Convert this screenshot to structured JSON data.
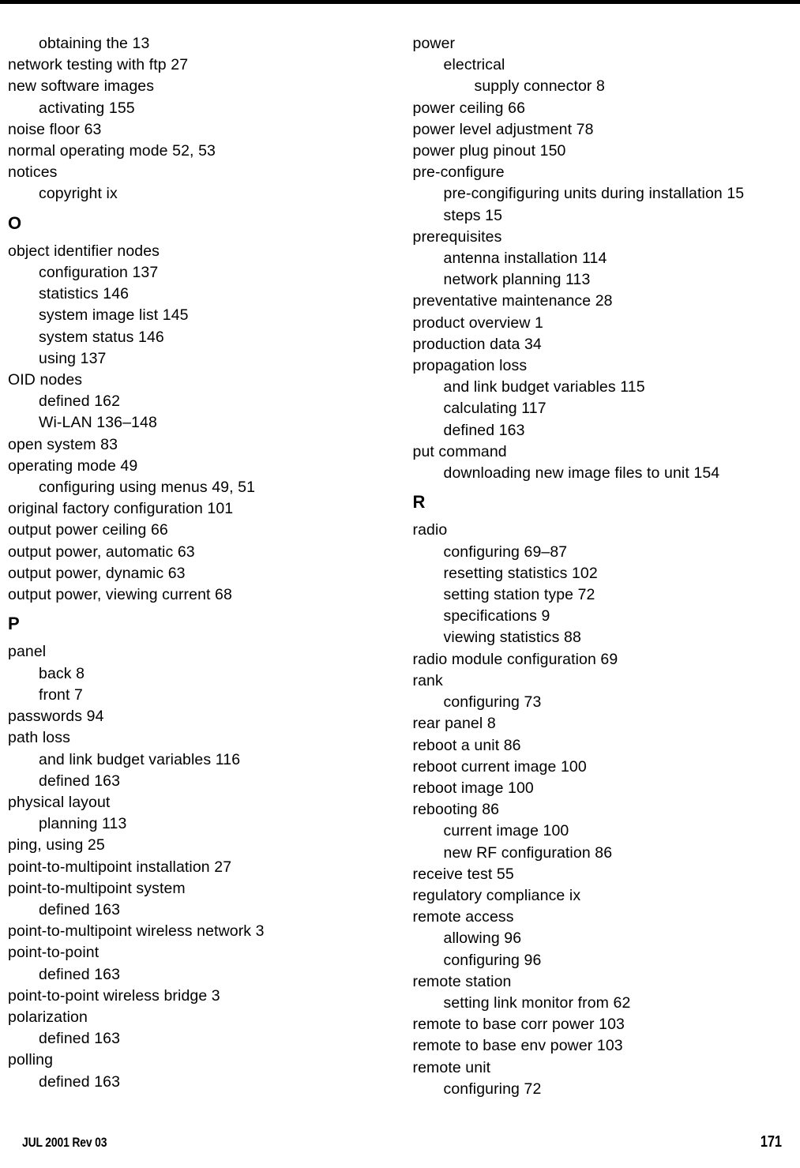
{
  "page": {
    "footer_left": "JUL 2001 Rev 03",
    "footer_right": "171",
    "rule_color": "#000000"
  },
  "index": {
    "left_column": [
      {
        "kind": "entry",
        "level": 1,
        "text": "obtaining the 13"
      },
      {
        "kind": "entry",
        "level": 0,
        "text": "network testing with ftp 27"
      },
      {
        "kind": "entry",
        "level": 0,
        "text": "new software images"
      },
      {
        "kind": "entry",
        "level": 1,
        "text": "activating 155"
      },
      {
        "kind": "entry",
        "level": 0,
        "text": "noise floor 63"
      },
      {
        "kind": "entry",
        "level": 0,
        "text": "normal operating mode 52, 53"
      },
      {
        "kind": "entry",
        "level": 0,
        "text": "notices"
      },
      {
        "kind": "entry",
        "level": 1,
        "text": "copyright ix"
      },
      {
        "kind": "letter",
        "level": 0,
        "text": "O"
      },
      {
        "kind": "entry",
        "level": 0,
        "text": "object identifier nodes"
      },
      {
        "kind": "entry",
        "level": 1,
        "text": "configuration 137"
      },
      {
        "kind": "entry",
        "level": 1,
        "text": "statistics 146"
      },
      {
        "kind": "entry",
        "level": 1,
        "text": "system image list 145"
      },
      {
        "kind": "entry",
        "level": 1,
        "text": "system status 146"
      },
      {
        "kind": "entry",
        "level": 1,
        "text": "using 137"
      },
      {
        "kind": "entry",
        "level": 0,
        "text": "OID nodes"
      },
      {
        "kind": "entry",
        "level": 1,
        "text": "defined 162"
      },
      {
        "kind": "entry",
        "level": 1,
        "text": "Wi-LAN 136–148"
      },
      {
        "kind": "entry",
        "level": 0,
        "text": "open system 83"
      },
      {
        "kind": "entry",
        "level": 0,
        "text": "operating mode 49"
      },
      {
        "kind": "entry",
        "level": 1,
        "text": "configuring using menus 49, 51"
      },
      {
        "kind": "entry",
        "level": 0,
        "text": "original factory configuration 101"
      },
      {
        "kind": "entry",
        "level": 0,
        "text": "output power ceiling 66"
      },
      {
        "kind": "entry",
        "level": 0,
        "text": "output power, automatic 63"
      },
      {
        "kind": "entry",
        "level": 0,
        "text": "output power, dynamic 63"
      },
      {
        "kind": "entry",
        "level": 0,
        "text": "output power, viewing current 68"
      },
      {
        "kind": "letter",
        "level": 0,
        "text": "P"
      },
      {
        "kind": "entry",
        "level": 0,
        "text": "panel"
      },
      {
        "kind": "entry",
        "level": 1,
        "text": "back 8"
      },
      {
        "kind": "entry",
        "level": 1,
        "text": "front 7"
      },
      {
        "kind": "entry",
        "level": 0,
        "text": "passwords 94"
      },
      {
        "kind": "entry",
        "level": 0,
        "text": "path loss"
      },
      {
        "kind": "entry",
        "level": 1,
        "text": "and link budget variables 116"
      },
      {
        "kind": "entry",
        "level": 1,
        "text": "defined 163"
      },
      {
        "kind": "entry",
        "level": 0,
        "text": "physical layout"
      },
      {
        "kind": "entry",
        "level": 1,
        "text": "planning 113"
      },
      {
        "kind": "entry",
        "level": 0,
        "text": "ping, using 25"
      },
      {
        "kind": "entry",
        "level": 0,
        "text": "point-to-multipoint installation 27"
      },
      {
        "kind": "entry",
        "level": 0,
        "text": "point-to-multipoint system"
      },
      {
        "kind": "entry",
        "level": 1,
        "text": "defined 163"
      },
      {
        "kind": "entry",
        "level": 0,
        "text": "point-to-multipoint wireless network 3"
      },
      {
        "kind": "entry",
        "level": 0,
        "text": "point-to-point"
      },
      {
        "kind": "entry",
        "level": 1,
        "text": "defined 163"
      },
      {
        "kind": "entry",
        "level": 0,
        "text": "point-to-point wireless bridge 3"
      },
      {
        "kind": "entry",
        "level": 0,
        "text": "polarization"
      },
      {
        "kind": "entry",
        "level": 1,
        "text": "defined 163"
      },
      {
        "kind": "entry",
        "level": 0,
        "text": "polling"
      },
      {
        "kind": "entry",
        "level": 1,
        "text": "defined 163"
      }
    ],
    "right_column": [
      {
        "kind": "entry",
        "level": 0,
        "text": "power"
      },
      {
        "kind": "entry",
        "level": 1,
        "text": "electrical"
      },
      {
        "kind": "entry",
        "level": 2,
        "text": "supply connector 8"
      },
      {
        "kind": "entry",
        "level": 0,
        "text": "power ceiling 66"
      },
      {
        "kind": "entry",
        "level": 0,
        "text": "power level adjustment 78"
      },
      {
        "kind": "entry",
        "level": 0,
        "text": "power plug pinout 150"
      },
      {
        "kind": "entry",
        "level": 0,
        "text": "pre-configure"
      },
      {
        "kind": "entry",
        "level": 1,
        "text": "pre-congifiguring units during installation 15"
      },
      {
        "kind": "entry",
        "level": 1,
        "text": "steps 15"
      },
      {
        "kind": "entry",
        "level": 0,
        "text": "prerequisites"
      },
      {
        "kind": "entry",
        "level": 1,
        "text": "antenna installation 114"
      },
      {
        "kind": "entry",
        "level": 1,
        "text": "network planning 113"
      },
      {
        "kind": "entry",
        "level": 0,
        "text": "preventative maintenance 28"
      },
      {
        "kind": "entry",
        "level": 0,
        "text": "product overview 1"
      },
      {
        "kind": "entry",
        "level": 0,
        "text": "production data 34"
      },
      {
        "kind": "entry",
        "level": 0,
        "text": "propagation loss"
      },
      {
        "kind": "entry",
        "level": 1,
        "text": "and link budget variables 115"
      },
      {
        "kind": "entry",
        "level": 1,
        "text": "calculating 117"
      },
      {
        "kind": "entry",
        "level": 1,
        "text": "defined 163"
      },
      {
        "kind": "entry",
        "level": 0,
        "text": "put command"
      },
      {
        "kind": "entry",
        "level": 1,
        "text": "downloading new image files to unit 154"
      },
      {
        "kind": "letter",
        "level": 0,
        "text": "R"
      },
      {
        "kind": "entry",
        "level": 0,
        "text": "radio"
      },
      {
        "kind": "entry",
        "level": 1,
        "text": "configuring 69–87"
      },
      {
        "kind": "entry",
        "level": 1,
        "text": "resetting statistics 102"
      },
      {
        "kind": "entry",
        "level": 1,
        "text": "setting station type 72"
      },
      {
        "kind": "entry",
        "level": 1,
        "text": "specifications 9"
      },
      {
        "kind": "entry",
        "level": 1,
        "text": "viewing statistics 88"
      },
      {
        "kind": "entry",
        "level": 0,
        "text": "radio module configuration 69"
      },
      {
        "kind": "entry",
        "level": 0,
        "text": "rank"
      },
      {
        "kind": "entry",
        "level": 1,
        "text": "configuring 73"
      },
      {
        "kind": "entry",
        "level": 0,
        "text": "rear panel 8"
      },
      {
        "kind": "entry",
        "level": 0,
        "text": "reboot a unit 86"
      },
      {
        "kind": "entry",
        "level": 0,
        "text": "reboot current image 100"
      },
      {
        "kind": "entry",
        "level": 0,
        "text": "reboot image 100"
      },
      {
        "kind": "entry",
        "level": 0,
        "text": "rebooting 86"
      },
      {
        "kind": "entry",
        "level": 1,
        "text": "current image 100"
      },
      {
        "kind": "entry",
        "level": 1,
        "text": "new RF configuration 86"
      },
      {
        "kind": "entry",
        "level": 0,
        "text": "receive test 55"
      },
      {
        "kind": "entry",
        "level": 0,
        "text": "regulatory compliance ix"
      },
      {
        "kind": "entry",
        "level": 0,
        "text": "remote access"
      },
      {
        "kind": "entry",
        "level": 1,
        "text": "allowing 96"
      },
      {
        "kind": "entry",
        "level": 1,
        "text": "configuring 96"
      },
      {
        "kind": "entry",
        "level": 0,
        "text": "remote station"
      },
      {
        "kind": "entry",
        "level": 1,
        "text": "setting link monitor from 62"
      },
      {
        "kind": "entry",
        "level": 0,
        "text": "remote to base corr power 103"
      },
      {
        "kind": "entry",
        "level": 0,
        "text": "remote to base env power 103"
      },
      {
        "kind": "entry",
        "level": 0,
        "text": "remote unit"
      },
      {
        "kind": "entry",
        "level": 1,
        "text": "configuring 72"
      }
    ]
  }
}
